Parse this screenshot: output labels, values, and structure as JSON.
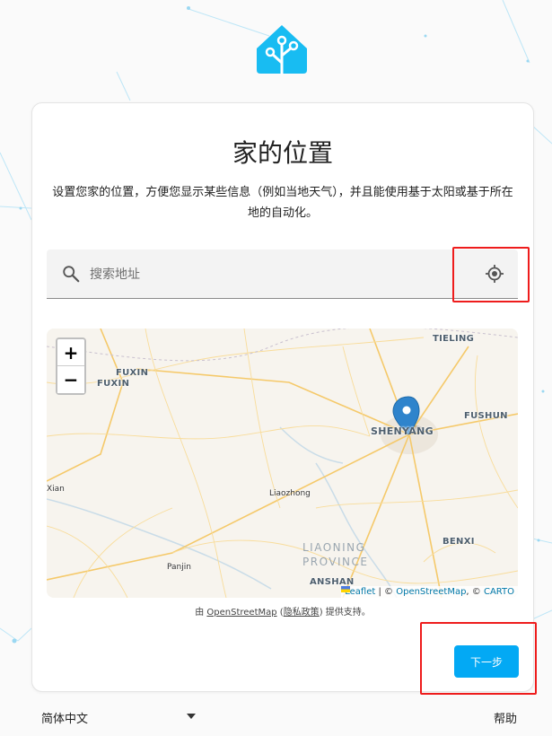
{
  "card": {
    "title": "家的位置",
    "description": "设置您家的位置，方便您显示某些信息（例如当地天气），并且能使用基于太阳或基于所在地的自动化。"
  },
  "search": {
    "placeholder": "搜索地址",
    "value": ""
  },
  "map": {
    "zoom_in": "+",
    "zoom_out": "−",
    "cities": {
      "tieling": "TIELING",
      "fuxin_1": "FUXIN",
      "fuxin_2": "FUXIN",
      "fushun": "FUSHUN",
      "shenyang": "SHENYANG",
      "benxi": "BENXI",
      "anshan": "ANSHAN"
    },
    "towns": {
      "xian": "Xian",
      "liaozhong": "Liaozhong",
      "panjin": "Panjin"
    },
    "region_line1": "LIAONING",
    "region_line2": "PROVINCE",
    "attribution": {
      "leaflet": "Leaflet",
      "sep1": " | © ",
      "osm": "OpenStreetMap",
      "sep2": ", © ",
      "carto": "CARTO"
    },
    "colors": {
      "land": "#f7f4ee",
      "road": "#f8d27a",
      "water": "#c9dce8",
      "marker": "#2f84cc"
    }
  },
  "provider": {
    "prefix": "由 ",
    "osm": "OpenStreetMap",
    "open_paren": " (",
    "privacy": "隐私政策",
    "suffix": ") 提供支持。"
  },
  "next_button": "下一步",
  "footer": {
    "language": "简体中文",
    "help": "帮助"
  },
  "colors": {
    "accent": "#03a9f4",
    "highlight": "#ee1c1c"
  }
}
